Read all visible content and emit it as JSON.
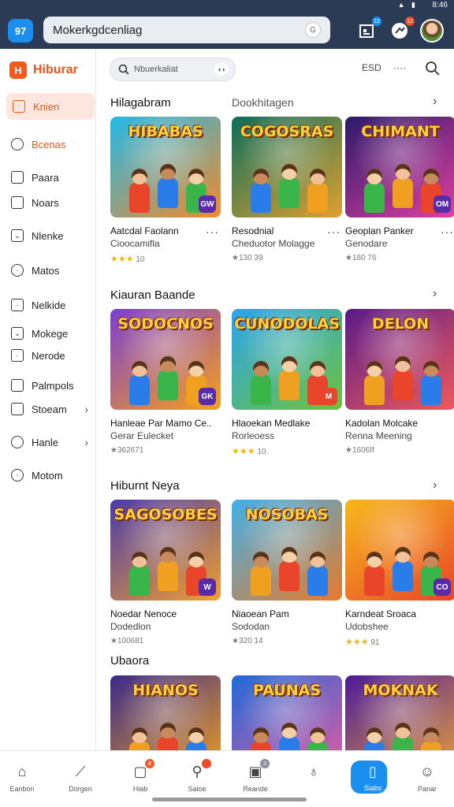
{
  "status": {
    "text": "8:46",
    "icons": "▲ ▮"
  },
  "topbar": {
    "logo_text": "97",
    "url": "Mokerkgdcenliag",
    "url_badge": "G",
    "badge1": "12",
    "badge2": "12"
  },
  "sidebar": {
    "brand_icon": "H",
    "brand": "Hiburar",
    "items": [
      {
        "label": "Knien",
        "icon": "square-icon",
        "active": true
      },
      {
        "label": "Bcenas",
        "icon": "home-icon"
      },
      {
        "label": "Paara",
        "icon": "square-icon"
      },
      {
        "label": "Noars",
        "icon": "square-icon"
      },
      {
        "label": "Nlenke",
        "icon": "inbox-icon"
      },
      {
        "label": "Matos",
        "icon": "circle-icon"
      },
      {
        "label": "Nelkide",
        "icon": "doc-icon"
      },
      {
        "label": "Mokege",
        "icon": "square-icon"
      },
      {
        "label": "Nerode",
        "icon": "square-icon"
      },
      {
        "label": "Palmpols",
        "icon": "bag-icon"
      },
      {
        "label": "Stoeam",
        "icon": "square-icon",
        "chevron": true
      },
      {
        "label": "Hanle",
        "icon": "person-icon",
        "chevron": true
      },
      {
        "label": "Motom",
        "icon": "circle-icon"
      }
    ]
  },
  "main": {
    "search_placeholder": "Nbuerkaliat",
    "search_mic": "◖◗",
    "filter_1": "ESD",
    "filter_2": "····",
    "sections": [
      {
        "title": "Hilagabram",
        "subtitle": "Dookhitagen",
        "cards": [
          {
            "thumb_title": "HIBABAS",
            "name": "Aatcdal Faolann",
            "sub": "Cioocamifla",
            "meta": "10",
            "stars": "★★★",
            "badge": "GW",
            "colors": [
              "#21b9e8",
              "#f48a2a"
            ]
          },
          {
            "thumb_title": "COGOSRAS",
            "name": "Resodnial",
            "sub": "Cheduotor Molagge",
            "meta": "★130 39",
            "stars": "",
            "badge": "",
            "colors": [
              "#0b6e5a",
              "#e0a030"
            ]
          },
          {
            "thumb_title": "CHIMANT",
            "name": "Geoplan Panker",
            "sub": "Genodare",
            "meta": "★180 76",
            "stars": "",
            "badge": "OM",
            "colors": [
              "#2a1a6a",
              "#e23fa0"
            ]
          }
        ]
      },
      {
        "title": "Kiauran Baande",
        "subtitle": "",
        "cards": [
          {
            "thumb_title": "SODOCNOS",
            "name": "Hanleae Par Mamo Ce..",
            "sub": "Gerar Eulecket",
            "meta": "★362671",
            "stars": "",
            "badge": "GK",
            "colors": [
              "#7b3fd0",
              "#f7a11a"
            ]
          },
          {
            "thumb_title": "CUNODOLAS",
            "name": "Hlaoekan Medlake",
            "sub": "Rorleoess",
            "meta": "10.",
            "stars": "★★★",
            "badge": "M",
            "colors": [
              "#2ba4ee",
              "#6dc23a"
            ]
          },
          {
            "thumb_title": "DELON",
            "name": "Kadolan Molcake",
            "sub": "Renna Meening",
            "meta": "★1606If",
            "stars": "",
            "badge": "",
            "colors": [
              "#5a1a8a",
              "#f05a5a"
            ]
          }
        ]
      },
      {
        "title": "Hiburnt Neya",
        "subtitle": "",
        "cards": [
          {
            "thumb_title": "SAGOSOBES",
            "name": "Noedar Nenoce",
            "sub": "Dodedlon",
            "meta": "★100681",
            "stars": "",
            "badge": "W",
            "colors": [
              "#4a3aa8",
              "#f0a030"
            ]
          },
          {
            "thumb_title": "NOSOBAS",
            "name": "Niaoean Pam",
            "sub": "Sododan",
            "meta": "★320 14",
            "stars": "",
            "badge": "",
            "colors": [
              "#3fb0e8",
              "#e87a2a"
            ]
          },
          {
            "thumb_title": "",
            "name": "Karndeat Sroaca",
            "sub": "Udobshee",
            "meta": "91",
            "stars": "★★★",
            "badge": "CO",
            "colors": [
              "#f7b81a",
              "#e8452a"
            ]
          }
        ]
      },
      {
        "title": "Ubaora",
        "subtitle": "",
        "cards": [
          {
            "thumb_title": "HIANOS",
            "name": "",
            "sub": "",
            "meta": "",
            "stars": "",
            "badge": "",
            "colors": [
              "#3a2a8a",
              "#f0a020"
            ]
          },
          {
            "thumb_title": "PAUNAS",
            "name": "",
            "sub": "",
            "meta": "",
            "stars": "",
            "badge": "",
            "colors": [
              "#1e6ad8",
              "#e85aa0"
            ]
          },
          {
            "thumb_title": "MOKNAK",
            "name": "",
            "sub": "",
            "meta": "",
            "stars": "",
            "badge": "",
            "colors": [
              "#4a1a9a",
              "#e8a03a"
            ]
          }
        ]
      }
    ]
  },
  "bottomnav": {
    "items": [
      {
        "label": "Eanbon",
        "icon": "⌂"
      },
      {
        "label": "Dorgen",
        "icon": "⟋"
      },
      {
        "label": "Hiab",
        "icon": "▢",
        "badge": "8"
      },
      {
        "label": "Saloe",
        "icon": "⚲",
        "badge": ""
      },
      {
        "label": "Reande",
        "icon": "▣",
        "badge": "3"
      },
      {
        "label": "",
        "icon": "♁"
      },
      {
        "label": "Siabs",
        "icon": "▯",
        "active": true
      },
      {
        "label": "Panar",
        "icon": "☺"
      }
    ]
  },
  "colors": {
    "accent": "#e8561b",
    "primary": "#1a8ff0",
    "topbar": "#2b3a55"
  }
}
